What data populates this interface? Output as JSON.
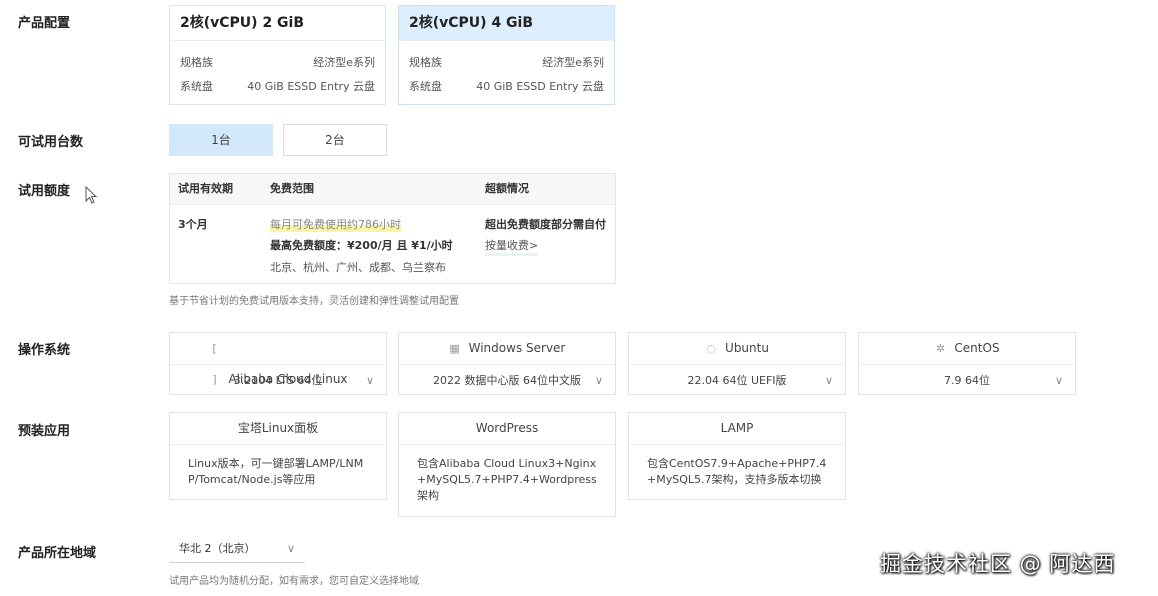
{
  "labels": {
    "product_config": "产品配置",
    "trial_count": "可试用台数",
    "trial_quota": "试用额度",
    "os": "操作系统",
    "preinstalled": "预装应用",
    "region": "产品所在地域"
  },
  "specs": [
    {
      "title": "2核(vCPU) 2 GiB",
      "family_key": "规格族",
      "family_val": "经济型e系列",
      "disk_key": "系统盘",
      "disk_val": "40 GiB ESSD Entry 云盘"
    },
    {
      "title": "2核(vCPU) 4 GiB",
      "family_key": "规格族",
      "family_val": "经济型e系列",
      "disk_key": "系统盘",
      "disk_val": "40 GiB ESSD Entry 云盘"
    }
  ],
  "quantity": [
    "1台",
    "2台"
  ],
  "trial": {
    "headers": [
      "试用有效期",
      "免费范围",
      "超额情况"
    ],
    "period": "3个月",
    "free_line1": "每月可免费使用约786小时",
    "free_line2": "最高免费额度：¥200/月 且 ¥1/小时",
    "free_line3": "北京、杭州、广州、成都、乌兰察布",
    "over_line1": "超出免费额度部分需自付",
    "over_line2": "按量收费>",
    "note": "基于节省计划的免费试用版本支持，灵活创建和弹性调整试用配置"
  },
  "os": [
    {
      "name": "Alibaba Cloud Linux",
      "version": "3.2104 LTS 64位",
      "icon": "alibaba-cloud-icon"
    },
    {
      "name": "Windows Server",
      "version": "2022 数据中心版 64位中文版",
      "icon": "windows-icon"
    },
    {
      "name": "Ubuntu",
      "version": "22.04 64位 UEFI版",
      "icon": "ubuntu-icon"
    },
    {
      "name": "CentOS",
      "version": "7.9 64位",
      "icon": "centos-icon"
    }
  ],
  "apps": [
    {
      "name": "宝塔Linux面板",
      "desc": "Linux版本，可一键部署LAMP/LNMP/Tomcat/Node.js等应用"
    },
    {
      "name": "WordPress",
      "desc": "包含Alibaba Cloud Linux3+Nginx+MySQL5.7+PHP7.4+Wordpress架构"
    },
    {
      "name": "LAMP",
      "desc": "包含CentOS7.9+Apache+PHP7.4+MySQL5.7架构，支持多版本切换"
    }
  ],
  "region": {
    "selected": "华北 2（北京）",
    "note": "试用产品均为随机分配，如有需求，您可自定义选择地域"
  },
  "watermark": "掘金技术社区 @ 阿达西"
}
